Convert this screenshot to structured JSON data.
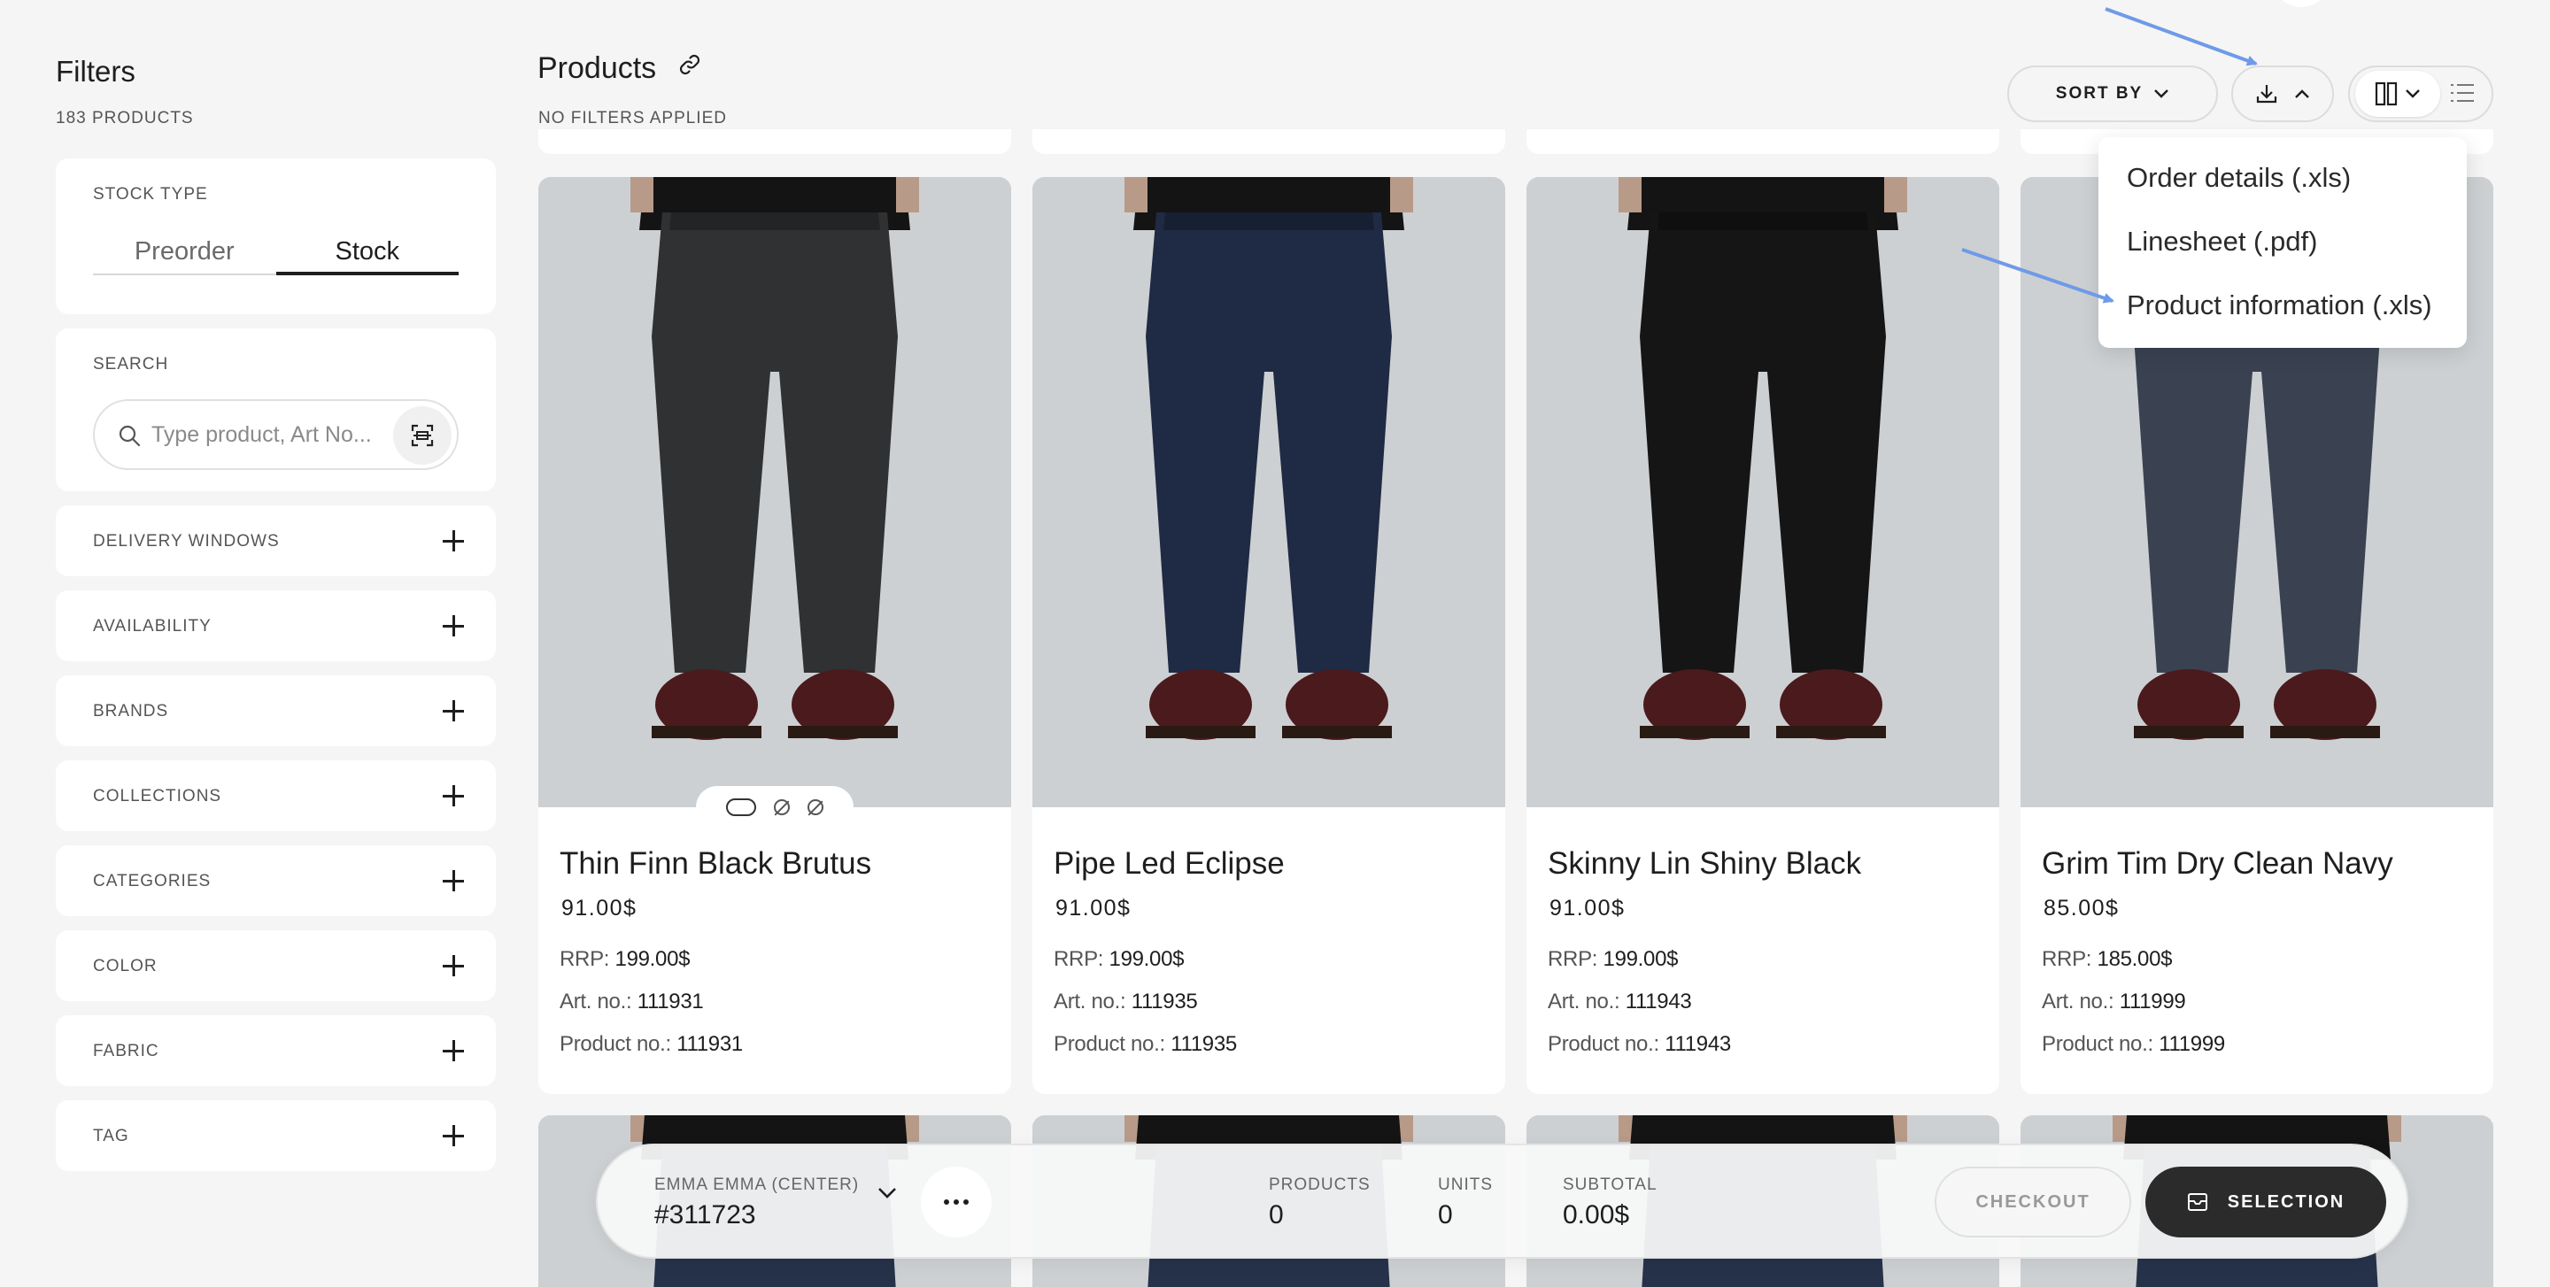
{
  "sidebar": {
    "title": "Filters",
    "product_count": "183 PRODUCTS",
    "stock_type": {
      "label": "STOCK TYPE",
      "options": [
        "Preorder",
        "Stock"
      ],
      "selected": "Stock"
    },
    "search": {
      "label": "SEARCH",
      "placeholder": "Type product, Art No..."
    },
    "filters": [
      "DELIVERY WINDOWS",
      "AVAILABILITY",
      "BRANDS",
      "COLLECTIONS",
      "CATEGORIES",
      "COLOR",
      "FABRIC",
      "TAG"
    ]
  },
  "header": {
    "title": "Products",
    "filters_status": "NO FILTERS APPLIED",
    "sort_label": "SORT BY"
  },
  "download_menu": {
    "items": [
      "Order details (.xls)",
      "Linesheet (.pdf)",
      "Product information (.xls)"
    ]
  },
  "products": [
    {
      "name": "Thin Finn Black Brutus",
      "price": "91.00$",
      "rrp_label": "RRP:",
      "rrp": "199.00$",
      "art_label": "Art. no.:",
      "art_no": "111931",
      "prod_label": "Product no.:",
      "product_no": "111931",
      "denim": "#2f3133"
    },
    {
      "name": "Pipe Led Eclipse",
      "price": "91.00$",
      "rrp_label": "RRP:",
      "rrp": "199.00$",
      "art_label": "Art. no.:",
      "art_no": "111935",
      "prod_label": "Product no.:",
      "product_no": "111935",
      "denim": "#1f2a44"
    },
    {
      "name": "Skinny Lin Shiny Black",
      "price": "91.00$",
      "rrp_label": "RRP:",
      "rrp": "199.00$",
      "art_label": "Art. no.:",
      "art_no": "111943",
      "prod_label": "Product no.:",
      "product_no": "111943",
      "denim": "#151515"
    },
    {
      "name": "Grim Tim Dry Clean Navy",
      "price": "85.00$",
      "rrp_label": "RRP:",
      "rrp": "185.00$",
      "art_label": "Art. no.:",
      "art_no": "111999",
      "prod_label": "Product no.:",
      "product_no": "111999",
      "denim": "#3a4252"
    }
  ],
  "bottom_bar": {
    "customer_label": "EMMA EMMA (CENTER)",
    "order_number": "#311723",
    "products_label": "PRODUCTS",
    "products_value": "0",
    "units_label": "UNITS",
    "units_value": "0",
    "subtotal_label": "SUBTOTAL",
    "subtotal_value": "0.00$",
    "checkout_label": "CHECKOUT",
    "selection_label": "SELECTION"
  },
  "colors": {
    "annotation_arrow": "#6f9ae8",
    "dark_button": "#2b2b2b",
    "background": "#f5f5f5"
  }
}
